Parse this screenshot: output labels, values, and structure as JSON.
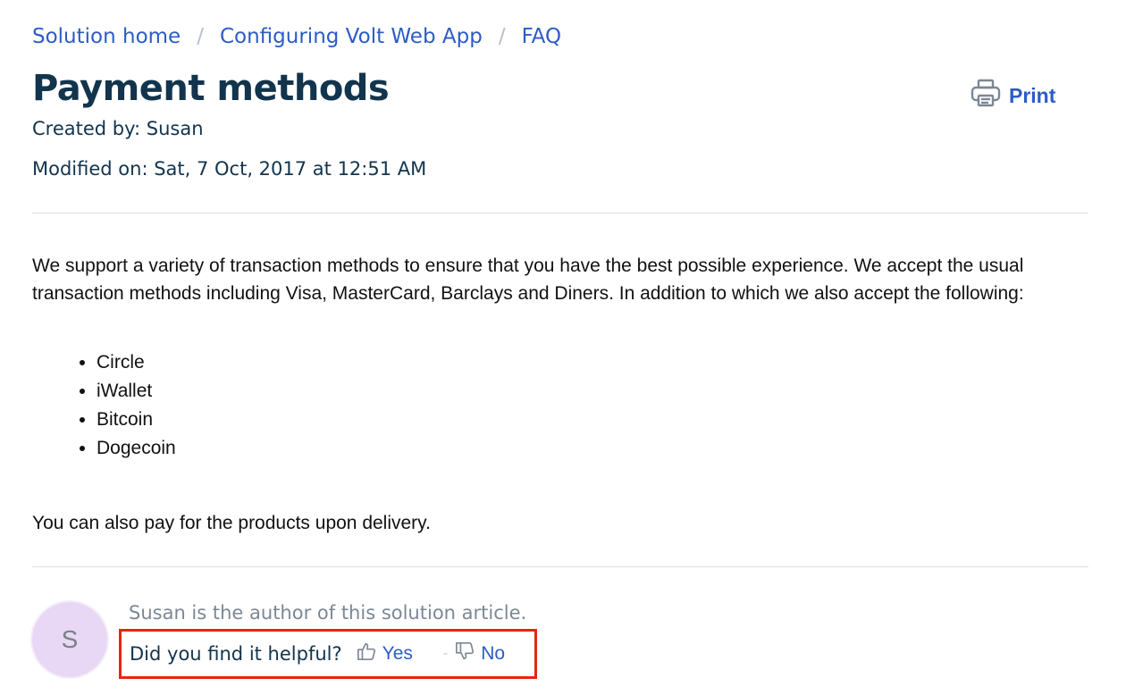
{
  "breadcrumb": {
    "items": [
      "Solution home",
      "Configuring Volt Web App",
      "FAQ"
    ],
    "separator": "/"
  },
  "article": {
    "title": "Payment methods",
    "created_by": "Created by: Susan",
    "modified_on": "Modified on: Sat, 7 Oct, 2017 at 12:51 AM",
    "intro": "We support a variety of transaction methods to ensure that you have the best possible experience. We accept the usual transaction methods including Visa, MasterCard, Barclays and Diners. In addition to which we also accept the following:",
    "methods": [
      "Circle",
      "iWallet",
      "Bitcoin",
      "Dogecoin"
    ],
    "closing": "You can also pay for the products upon delivery."
  },
  "toolbar": {
    "print_label": "Print",
    "print_icon": "printer-icon"
  },
  "author": {
    "avatar_initial": "S",
    "line": "Susan is the author of this solution article."
  },
  "feedback": {
    "question": "Did you find it helpful?",
    "yes_label": "Yes",
    "no_label": "No",
    "separator": "-",
    "highlight_color": "#e8250f"
  },
  "colors": {
    "link": "#2c5cc5",
    "heading": "#12344d"
  }
}
